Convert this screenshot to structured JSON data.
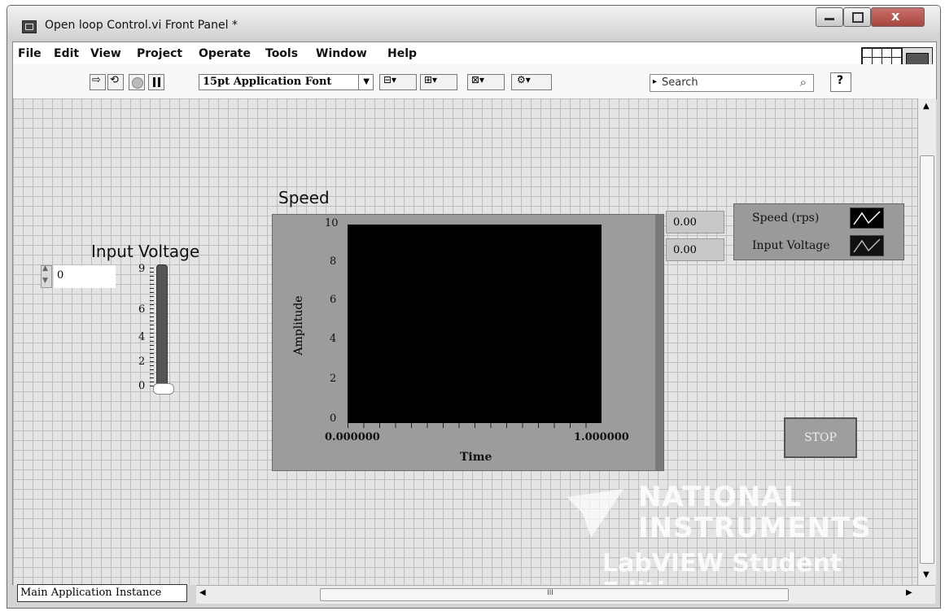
{
  "window": {
    "title": "Open loop Control.vi Front Panel *",
    "buttons": [
      "minimize",
      "maximize",
      "close"
    ]
  },
  "menu": {
    "items": [
      "File",
      "Edit",
      "View",
      "Project",
      "Operate",
      "Tools",
      "Window",
      "Help"
    ]
  },
  "toolbar": {
    "font": "15pt Application Font",
    "search_placeholder": "Search"
  },
  "panel": {
    "input_voltage": {
      "label": "Input Voltage",
      "value": "0",
      "scale": [
        "9",
        "6",
        "4",
        "2",
        "0"
      ],
      "level": 0
    },
    "graph": {
      "title": "Speed",
      "y_ticks": [
        "10",
        "8",
        "6",
        "4",
        "2",
        "0"
      ],
      "x_min": "0.000000",
      "x_max": "1.000000",
      "xlabel": "Time",
      "ylabel": "Amplitude",
      "digital_display": [
        "0.00",
        "0.00"
      ],
      "legend": [
        "Speed (rps)",
        "Input Voltage"
      ]
    },
    "stop_label": "STOP",
    "watermark": {
      "line1": "NATIONAL",
      "line2": "INSTRUMENTS",
      "line3": "LabVIEW Student Edition"
    }
  },
  "status": {
    "instance": "Main Application Instance",
    "scroll_mark": "III"
  }
}
